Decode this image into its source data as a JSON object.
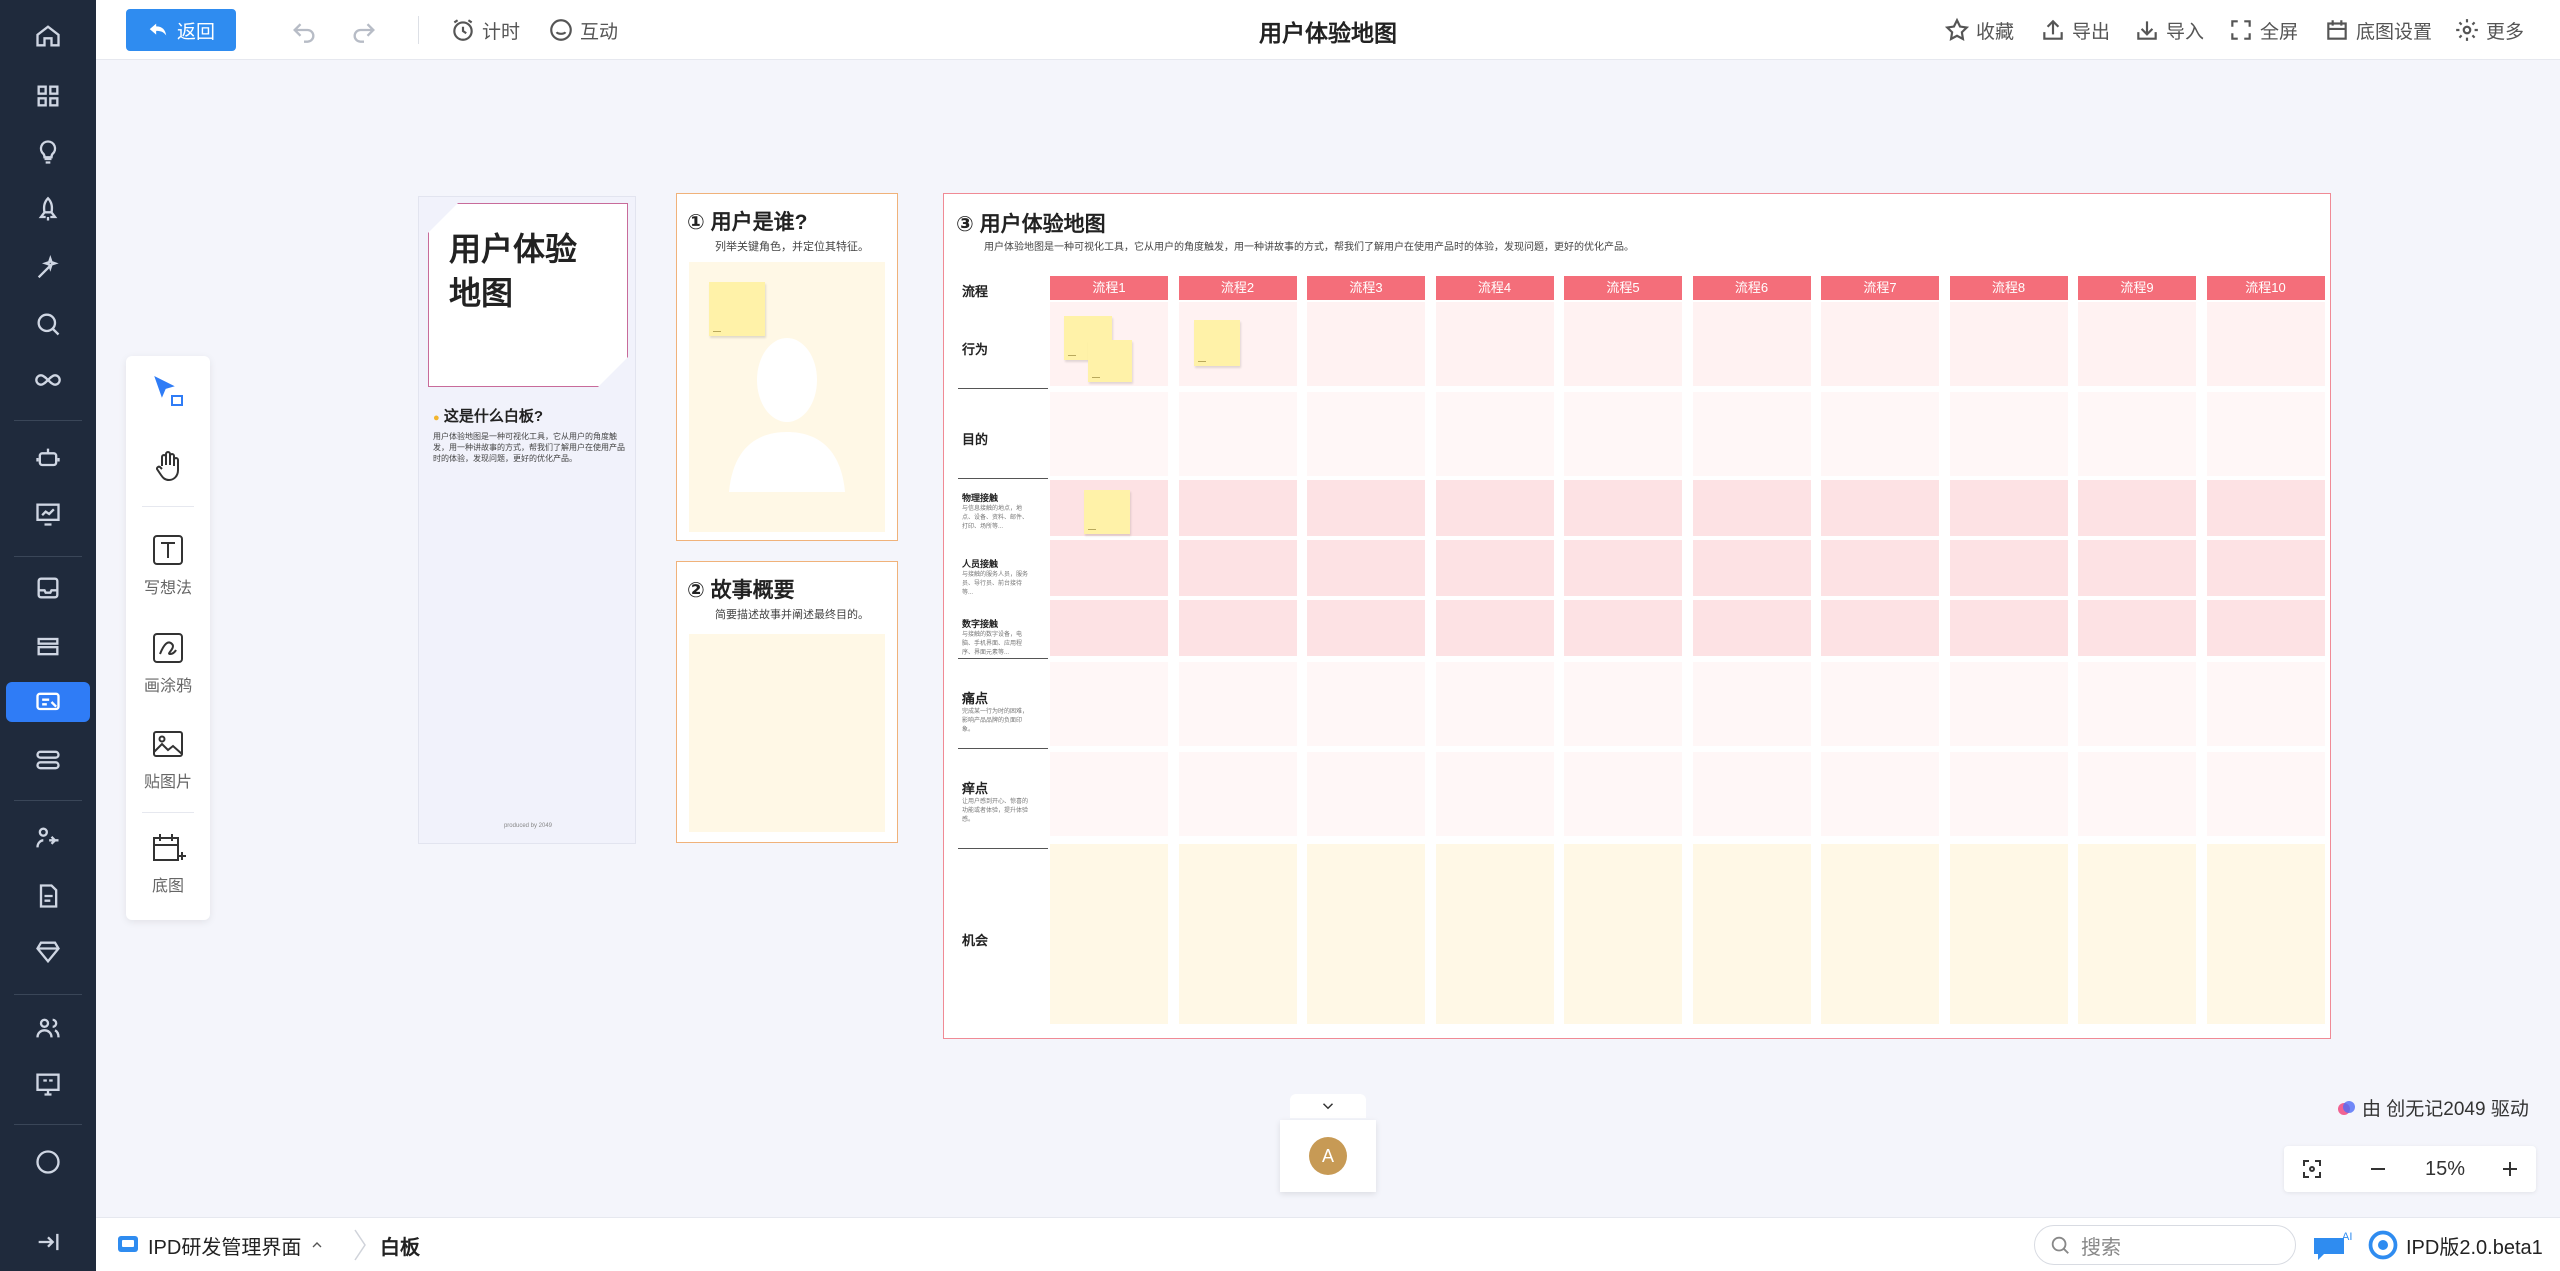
{
  "topbar": {
    "back_label": "返回",
    "timer_label": "计时",
    "interact_label": "互动",
    "title": "用户体验地图",
    "actions": {
      "favorite": "收藏",
      "export": "导出",
      "import": "导入",
      "fullscreen": "全屏",
      "background_settings": "底图设置",
      "more": "更多"
    }
  },
  "toolbox": {
    "text": "写想法",
    "draw": "画涂鸦",
    "image": "贴图片",
    "background": "底图"
  },
  "cover": {
    "title": "用户体验地图",
    "question": "这是什么白板?",
    "desc": "用户体验地图是一种可视化工具，它从用户的角度触发，用一种讲故事的方式，帮我们了解用户在使用产品时的体验，发现问题，更好的优化产品。",
    "footer": "produced by 2049"
  },
  "who_card": {
    "title": "① 用户是谁?",
    "subtitle": "列举关键角色，并定位其特征。"
  },
  "story_card": {
    "title": "② 故事概要",
    "subtitle": "简要描述故事并阐述最终目的。"
  },
  "map_card": {
    "title": "③ 用户体验地图",
    "subtitle": "用户体验地图是一种可视化工具，它从用户的角度触发，用一种讲故事的方式，帮我们了解用户在使用产品时的体验，发现问题，更好的优化产品。",
    "process_label": "流程",
    "stages": [
      "流程1",
      "流程2",
      "流程3",
      "流程4",
      "流程5",
      "流程6",
      "流程7",
      "流程8",
      "流程9",
      "流程10"
    ],
    "rows": [
      {
        "label": "行为",
        "desc": ""
      },
      {
        "label": "目的",
        "desc": ""
      },
      {
        "label": "物理接触",
        "desc": "与信息接触的地点，地点、设备、资料、邮件、打印、场所等..."
      },
      {
        "label": "人员接触",
        "desc": "与接触的服务人员，服务员、导行员、前台接待等..."
      },
      {
        "label": "数字接触",
        "desc": "与接触的数字设备，电脑、手机界面、应用程序、界面元素等..."
      },
      {
        "label": "痛点",
        "desc": "完成某一行为时的困难，影响产品品牌的负面印象。"
      },
      {
        "label": "痒点",
        "desc": "让用户感到开心、惊喜的功能或者体验，提升体验感。"
      },
      {
        "label": "机会",
        "desc": ""
      }
    ]
  },
  "powered": "由 创无记2049 驱动",
  "zoom": "15%",
  "collab": {
    "avatar_initial": "A"
  },
  "bottombar": {
    "workspace": "IPD研发管理界面",
    "current": "白板",
    "search_placeholder": "搜索",
    "version": "IPD版2.0.beta1"
  },
  "colors": {
    "accent": "#2f8cf0",
    "sidebar": "#1f2a3c",
    "stage": "#f46e7a",
    "sticky": "#fff2a8"
  }
}
